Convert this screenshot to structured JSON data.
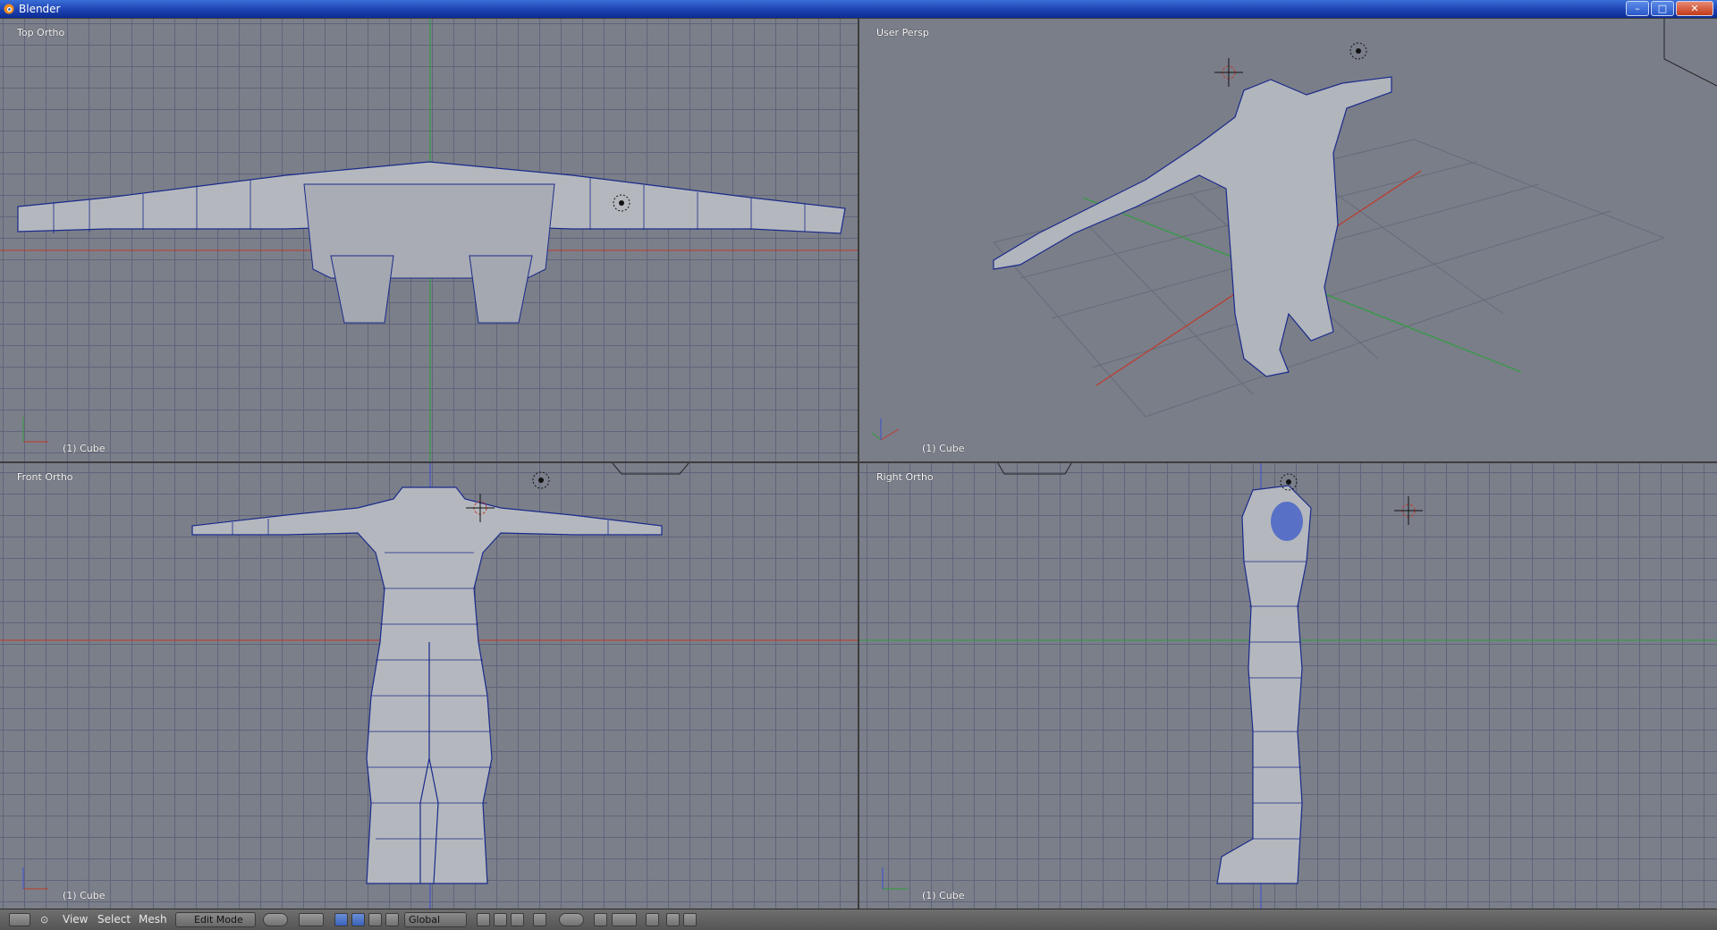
{
  "window": {
    "title": "Blender",
    "controls": {
      "minimize": "–",
      "maximize": "□",
      "close": "✕"
    }
  },
  "viewports": {
    "top": {
      "label": "Top Ortho",
      "object": "(1) Cube"
    },
    "persp": {
      "label": "User Persp",
      "object": "(1) Cube"
    },
    "front": {
      "label": "Front Ortho",
      "object": "(1) Cube"
    },
    "right": {
      "label": "Right Ortho",
      "object": "(1) Cube"
    }
  },
  "header": {
    "menu": {
      "view": "View",
      "select": "Select",
      "mesh": "Mesh"
    },
    "mode": "Edit Mode",
    "orientation": "Global",
    "icons": [
      "editor-type-icon",
      "menu-toggle-icon",
      "mode-icon",
      "viewport-shading-icon",
      "pivot-icon",
      "manipulator-translate-icon",
      "manipulator-rotate-icon",
      "manipulator-scale-icon",
      "vertex-select-icon",
      "edge-select-icon",
      "face-select-icon",
      "limit-to-visible-icon",
      "proportional-edit-icon",
      "snap-icon",
      "snap-element-icon",
      "opengl-render-icon",
      "opengl-animation-icon"
    ]
  },
  "colors": {
    "viewport_bg": "#7b7f8a",
    "grid": "#60647a",
    "axis_x": "#c0392b",
    "axis_y": "#2e9e3e",
    "axis_z": "#3b4fd0",
    "wire": "#1a2a8a",
    "mesh": "#b4b8be"
  }
}
